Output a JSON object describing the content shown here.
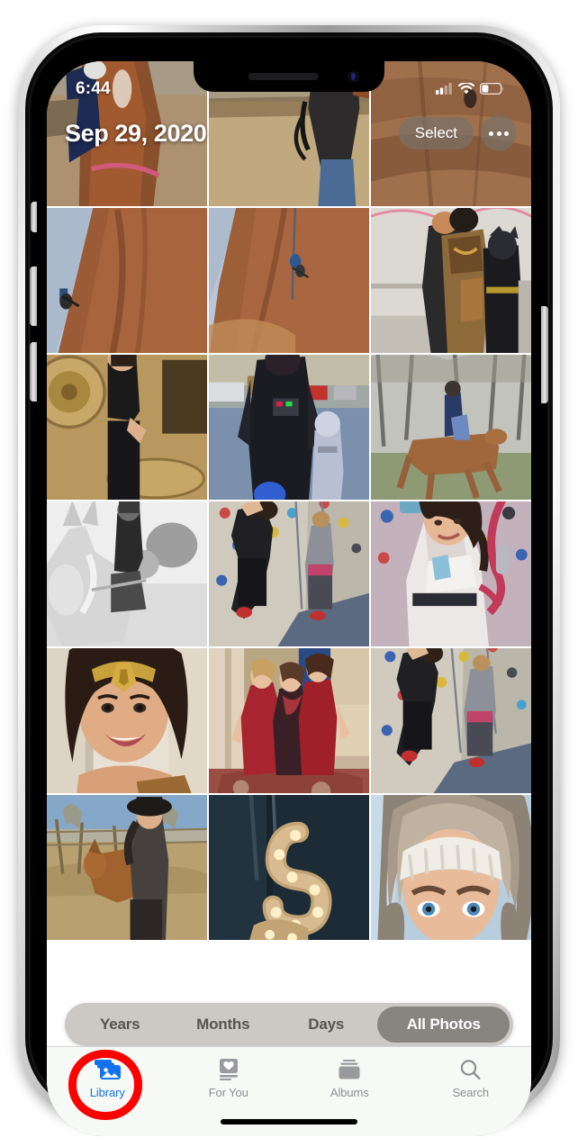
{
  "device": {
    "name": "iphone-x-silver"
  },
  "status_bar": {
    "time": "6:44",
    "cellular_icon": "cellular-signal-icon",
    "cellular_bars_filled": 2,
    "cellular_bars_total": 4,
    "wifi_icon": "wifi-icon",
    "battery_icon": "battery-icon",
    "battery_level_percent": 32
  },
  "header": {
    "date_title": "Sep 29, 2020",
    "select_label": "Select",
    "more_icon": "ellipsis-icon"
  },
  "segmented_control": {
    "options": [
      {
        "label": "Years",
        "selected": false
      },
      {
        "label": "Months",
        "selected": false
      },
      {
        "label": "Days",
        "selected": false
      },
      {
        "label": "All Photos",
        "selected": true
      }
    ]
  },
  "tab_bar": {
    "items": [
      {
        "label": "Library",
        "icon": "photo-library-icon",
        "active": true
      },
      {
        "label": "For You",
        "icon": "heart-card-icon",
        "active": false
      },
      {
        "label": "Albums",
        "icon": "albums-stack-icon",
        "active": false
      },
      {
        "label": "Search",
        "icon": "search-icon",
        "active": false
      }
    ]
  },
  "annotation": {
    "type": "red-oval-highlight",
    "target": "Library",
    "color": "#fe0000"
  },
  "colors": {
    "accent_blue": "#1272ec",
    "tab_inactive": "#8e8e93",
    "annotation_red": "#fe0000",
    "pill_grey": "rgba(120,112,104,.72)",
    "segment_bg": "rgba(195,190,185,.85)"
  },
  "photo_grid": {
    "columns": 3,
    "photos": [
      {
        "id": "p1",
        "subject": "Closeup of chestnut horse with rider leg, dirt paddock"
      },
      {
        "id": "p2",
        "subject": "Woman in dark top leading horse by reins in arena"
      },
      {
        "id": "p3",
        "subject": "Red sandstone rock face with distant climber"
      },
      {
        "id": "p4",
        "subject": "Climber on large red rock slab, blue sky"
      },
      {
        "id": "p5",
        "subject": "Climber rappelling down tall red rock fin"
      },
      {
        "id": "p6",
        "subject": "Woman in Wonder Woman costume beside child in Batman costume"
      },
      {
        "id": "p7",
        "subject": "Woman in black crop top and pants standing on patterned rug"
      },
      {
        "id": "p8",
        "subject": "Woman in Darth Vader cape with child stormtrooper in parking lot"
      },
      {
        "id": "p9",
        "subject": "Rider on chestnut horse galloping past bare trees"
      },
      {
        "id": "p10",
        "subject": "Black and white photo of woman riding light horse in field"
      },
      {
        "id": "p11",
        "subject": "Woman climbing indoor rock wall, belayer below"
      },
      {
        "id": "p12",
        "subject": "Smiling woman in white tank top holding climbing rope"
      },
      {
        "id": "p13",
        "subject": "Selfie of woman with gold Wonder Woman headpiece"
      },
      {
        "id": "p14",
        "subject": "Three women in red and floral formal gowns indoors"
      },
      {
        "id": "p15",
        "subject": "Woman climbing indoor wall with second climber at right"
      },
      {
        "id": "p16",
        "subject": "Woman in black hat standing with horse in winter pasture"
      },
      {
        "id": "p17",
        "subject": "Illuminated marquee letter 'S' light on dark wall"
      },
      {
        "id": "p18",
        "subject": "Selfie of woman in white knit hat and fur-trimmed hood"
      }
    ]
  }
}
